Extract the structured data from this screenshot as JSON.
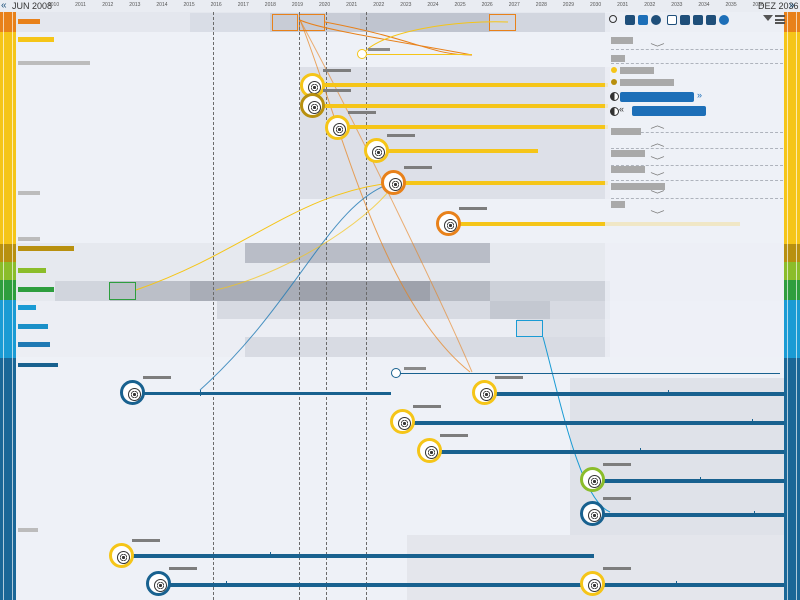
{
  "timeline": {
    "start_label": "JUN 2008",
    "end_label": "DEZ 2036",
    "prev_arrow": "«",
    "next_arrow": "»",
    "years": [
      "2010",
      "2011",
      "2012",
      "2013",
      "2014",
      "2015",
      "2016",
      "2017",
      "2018",
      "2019",
      "2020",
      "2021",
      "2022",
      "2023",
      "2024",
      "2025",
      "2026",
      "2027",
      "2028",
      "2029",
      "2030",
      "2031",
      "2032",
      "2033",
      "2034",
      "2035",
      "2036"
    ]
  },
  "toolbar": {
    "icons": [
      "search-icon",
      "grid-icon",
      "grid-alt-icon",
      "ring-icon",
      "info-icon",
      "bar-icon",
      "layers-icon",
      "target-icon",
      "compass-icon",
      "filter-icon",
      "stack-icon"
    ]
  },
  "right_panel": {
    "expand_left": "«",
    "expand_right": "»",
    "chevron": "﹀",
    "chevron_up": "︿"
  },
  "colors": {
    "orange": "#e8811a",
    "yellow": "#f5c518",
    "olive": "#b8900f",
    "green": "#8bbd2a",
    "dark_green": "#2e9e3e",
    "cyan": "#1a9bd4",
    "blue": "#1f79b4",
    "navy": "#18618f",
    "selection": "#1d6fb8"
  }
}
